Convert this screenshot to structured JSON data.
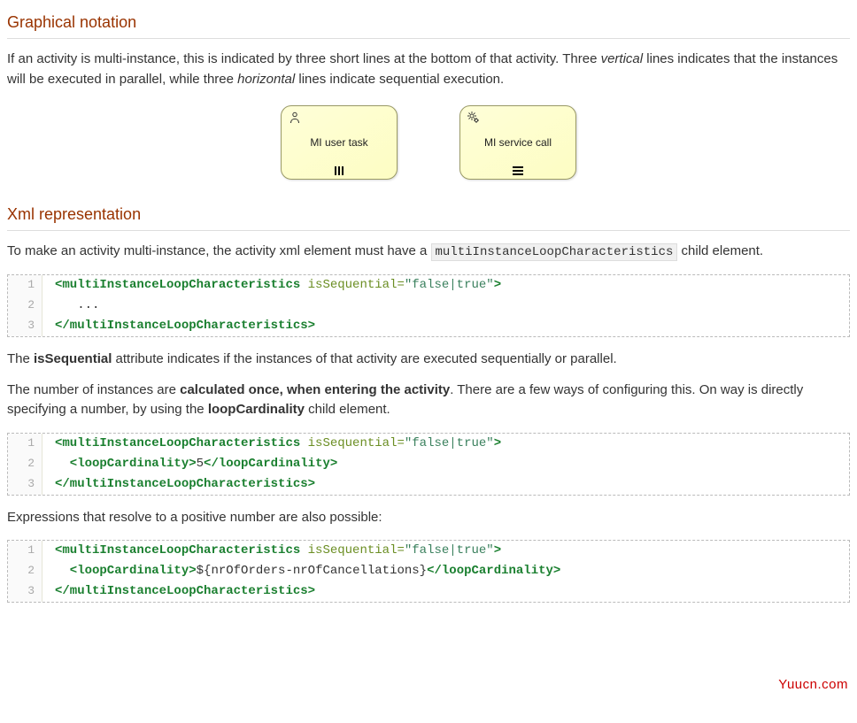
{
  "section1": {
    "title": "Graphical notation",
    "p1_a": "If an activity is multi-instance, this is indicated by three short lines at the bottom of that activity. Three ",
    "p1_em1": "vertical",
    "p1_b": " lines indicates that the instances will be executed in parallel, while three ",
    "p1_em2": "horizontal",
    "p1_c": " lines indicate sequential execution."
  },
  "diagram": {
    "user_task_label": "MI user task",
    "service_task_label": "MI service call"
  },
  "section2": {
    "title": "Xml representation",
    "p1_a": "To make an activity multi-instance, the activity xml element must have a ",
    "p1_code": "multiInstanceLoopCharacteristics",
    "p1_b": " child element."
  },
  "code1": {
    "l1_open": "<multiInstanceLoopCharacteristics",
    "l1_attr": " isSequential=",
    "l1_str": "\"false|true\"",
    "l1_close": ">",
    "l2": "   ...",
    "l3": "</multiInstanceLoopCharacteristics>"
  },
  "p3_a": "The ",
  "p3_s1": "isSequential",
  "p3_b": " attribute indicates if the instances of that activity are executed sequentially or parallel.",
  "p4_a": "The number of instances are ",
  "p4_s1": "calculated once, when entering the activity",
  "p4_b": ". There are a few ways of configuring this. On way is directly specifying a number, by using the ",
  "p4_s2": "loopCardinality",
  "p4_c": " child element.",
  "code2": {
    "l1_open": "<multiInstanceLoopCharacteristics",
    "l1_attr": " isSequential=",
    "l1_str": "\"false|true\"",
    "l1_close": ">",
    "l2_open": "  <loopCardinality>",
    "l2_text": "5",
    "l2_close": "</loopCardinality>",
    "l3": "</multiInstanceLoopCharacteristics>"
  },
  "p5": "Expressions that resolve to a positive number are also possible:",
  "code3": {
    "l1_open": "<multiInstanceLoopCharacteristics",
    "l1_attr": " isSequential=",
    "l1_str": "\"false|true\"",
    "l1_close": ">",
    "l2_open": "  <loopCardinality>",
    "l2_text": "${nrOfOrders-nrOfCancellations}",
    "l2_close": "</loopCardinality>",
    "l3": "</multiInstanceLoopCharacteristics>"
  },
  "watermark": "Yuucn.com"
}
